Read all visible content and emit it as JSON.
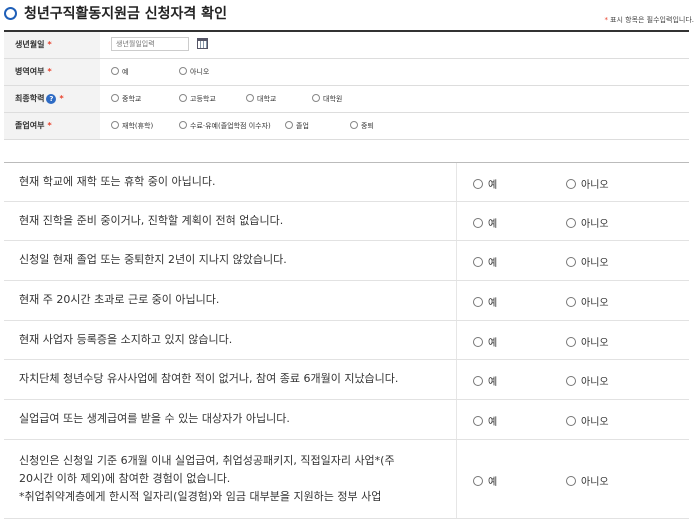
{
  "header": {
    "title": "청년구직활동지원금 신청자격 확인",
    "required_note": "표시 항목은 필수입력입니다.",
    "required_mark": "*"
  },
  "form": {
    "birth": {
      "label": "생년월일",
      "placeholder": "생년월일입력"
    },
    "military": {
      "label": "병역여부",
      "options": [
        "예",
        "아니오"
      ]
    },
    "education": {
      "label": "최종학력",
      "help": "?",
      "options": [
        "중학교",
        "고등학교",
        "대학교",
        "대학원"
      ]
    },
    "graduation": {
      "label": "졸업여부",
      "options": [
        "재학(휴학)",
        "수료·유예(졸업학점 이수자)",
        "졸업",
        "중퇴"
      ]
    }
  },
  "questions": [
    {
      "text": [
        "현재 학교에 재학 또는 휴학 중이 아닙니다."
      ],
      "yes": "예",
      "no": "아니오"
    },
    {
      "text": [
        "현재 진학을 준비 중이거나, 진학할 계획이 전혀 없습니다."
      ],
      "yes": "예",
      "no": "아니오"
    },
    {
      "text": [
        "신청일 현재 졸업 또는 중퇴한지 2년이 지나지 않았습니다."
      ],
      "yes": "예",
      "no": "아니오"
    },
    {
      "text": [
        "현재 주 20시간 초과로 근로 중이 아닙니다."
      ],
      "yes": "예",
      "no": "아니오"
    },
    {
      "text": [
        "현재 사업자 등록증을 소지하고 있지 않습니다."
      ],
      "yes": "예",
      "no": "아니오"
    },
    {
      "text": [
        "자치단체 청년수당 유사사업에 참여한 적이 없거나, 참여 종료 6개월이 지났습니다."
      ],
      "yes": "예",
      "no": "아니오"
    },
    {
      "text": [
        "실업급여 또는 생계급여를 받을 수 있는 대상자가 아닙니다."
      ],
      "yes": "예",
      "no": "아니오"
    },
    {
      "text": [
        "신청인은 신청일 기준 6개월 이내 실업급여, 취업성공패키지, 직접일자리 사업*(주",
        "20시간 이하 제외)에 참여한 경험이 없습니다.",
        "*취업취약계층에게 한시적 일자리(일경험)와 임금 대부분을 지원하는 정부 사업"
      ],
      "yes": "예",
      "no": "아니오"
    }
  ],
  "colors": {
    "accent": "#1f5fb8",
    "required": "#e8412b"
  }
}
